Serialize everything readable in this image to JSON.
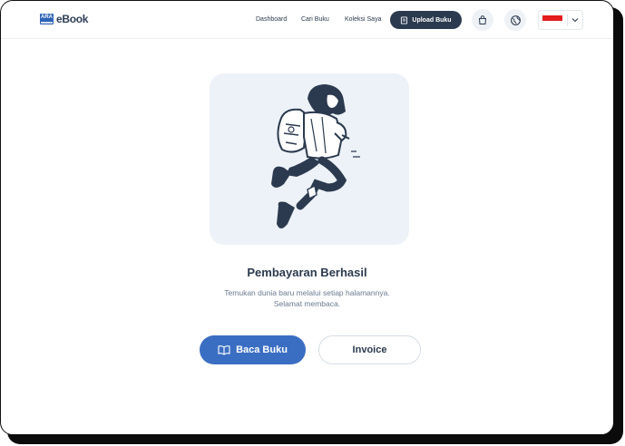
{
  "header": {
    "logo_mark": "ARA",
    "logo_text": "eBook",
    "nav": [
      "Dashboard",
      "Cari Buku",
      "Koleksi Saya"
    ],
    "upload_label": "Upload Buku"
  },
  "lang": {
    "selected": "ID"
  },
  "main": {
    "title": "Pembayaran Berhasil",
    "subtitle_line1": "Temukan dunia baru melalui setiap halamannya.",
    "subtitle_line2": "Selamat membaca.",
    "read_button": "Baca Buku",
    "invoice_button": "Invoice"
  },
  "colors": {
    "primary": "#3a6ec2",
    "dark": "#2b3a4f",
    "illustration_bg": "#edf2f8",
    "flag_red": "#e41c1c"
  },
  "icons": [
    "book-icon",
    "bag-icon",
    "globe-icon",
    "chevron-down-icon",
    "upload-book-icon"
  ]
}
